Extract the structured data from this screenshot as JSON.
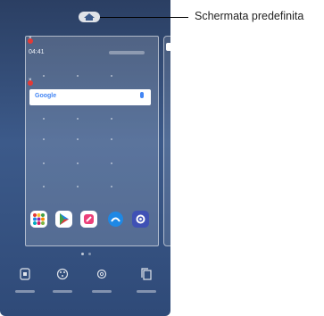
{
  "callout": {
    "label": "Schermata predefinita"
  },
  "homescreen": {
    "clock": "04:41",
    "search_logo": "Google",
    "icons": [
      "home-icon",
      "close-icon",
      "apps-icon",
      "play-store-icon",
      "pen-icon",
      "browser-icon",
      "settings-icon",
      "widgets-icon",
      "theme-icon",
      "gear-icon",
      "copy-icon"
    ]
  },
  "colors": {
    "wallpaper_top": "#2b3f63",
    "wallpaper_bottom": "#2f4a78",
    "close_dot": "#e53935",
    "google_blue": "#4285f4"
  }
}
